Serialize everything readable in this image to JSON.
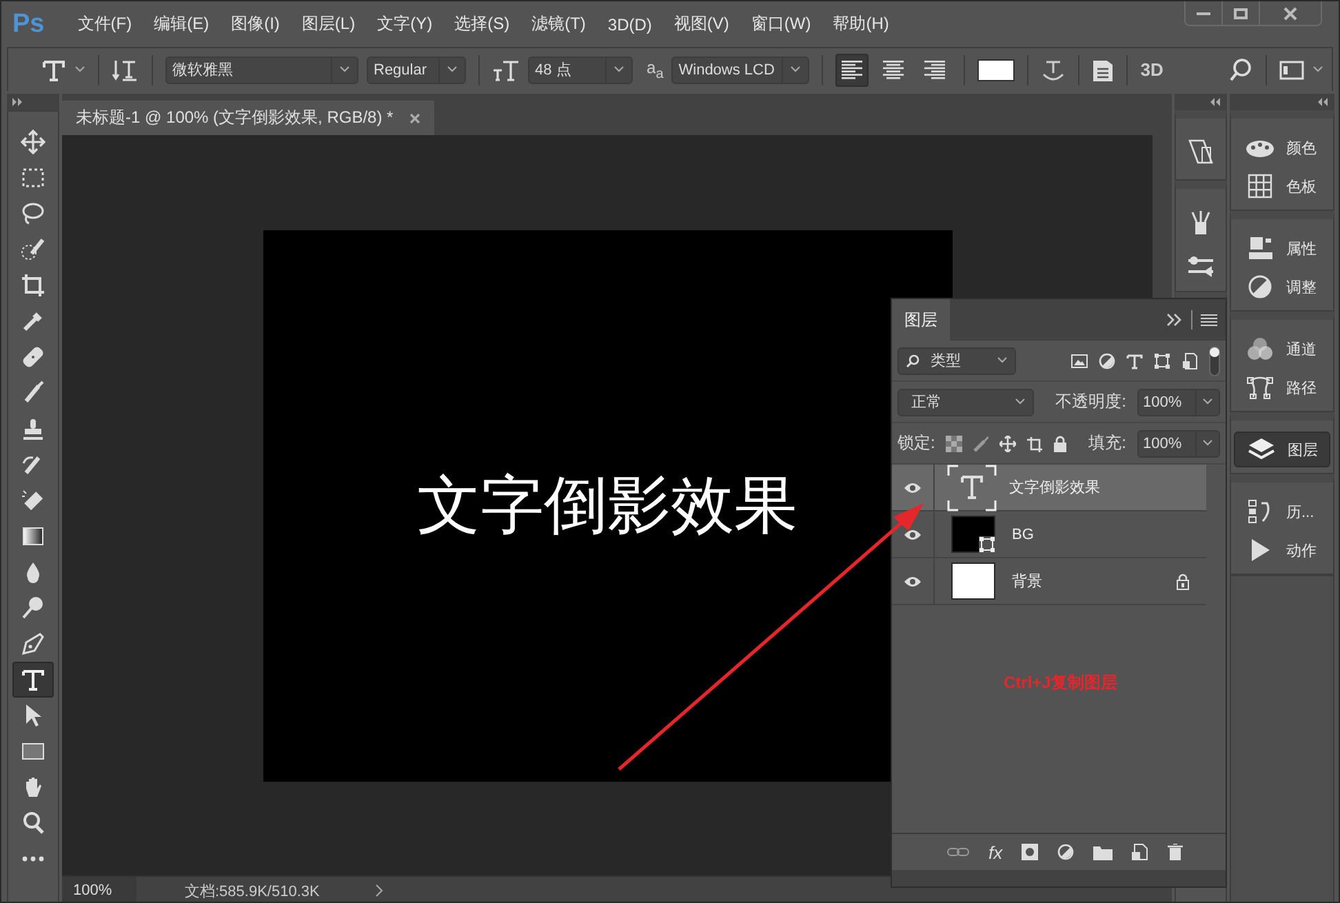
{
  "app": {
    "logo": "Ps"
  },
  "menu": [
    {
      "label": "文件(F)"
    },
    {
      "label": "编辑(E)"
    },
    {
      "label": "图像(I)"
    },
    {
      "label": "图层(L)"
    },
    {
      "label": "文字(Y)"
    },
    {
      "label": "选择(S)"
    },
    {
      "label": "滤镜(T)"
    },
    {
      "label": "3D(D)"
    },
    {
      "label": "视图(V)"
    },
    {
      "label": "窗口(W)"
    },
    {
      "label": "帮助(H)"
    }
  ],
  "options_bar": {
    "font_family": "微软雅黑",
    "font_style": "Regular",
    "font_size": "48 点",
    "antialias_icon": "a$_{a}$",
    "antialias": "Windows LCD",
    "align": [
      {
        "kind": "left",
        "selected": true
      },
      {
        "kind": "center",
        "selected": false
      },
      {
        "kind": "right",
        "selected": false
      }
    ],
    "three_d": "3D"
  },
  "document_tab": {
    "title": "未标题-1 @ 100% (文字倒影效果, RGB/8) *"
  },
  "tools": [
    {
      "kind": "move",
      "selected": false
    },
    {
      "kind": "marquee",
      "selected": false
    },
    {
      "kind": "lasso",
      "selected": false
    },
    {
      "kind": "quick-select",
      "selected": false
    },
    {
      "kind": "crop",
      "selected": false
    },
    {
      "kind": "eyedropper",
      "selected": false
    },
    {
      "kind": "healing",
      "selected": false
    },
    {
      "kind": "brush",
      "selected": false
    },
    {
      "kind": "stamp",
      "selected": false
    },
    {
      "kind": "history-brush",
      "selected": false
    },
    {
      "kind": "eraser",
      "selected": false
    },
    {
      "kind": "gradient",
      "selected": false
    },
    {
      "kind": "blur",
      "selected": false
    },
    {
      "kind": "dodge",
      "selected": false
    },
    {
      "kind": "pen",
      "selected": false
    },
    {
      "kind": "type",
      "selected": true
    },
    {
      "kind": "path-select",
      "selected": false
    },
    {
      "kind": "rectangle",
      "selected": false
    },
    {
      "kind": "hand",
      "selected": false
    },
    {
      "kind": "zoom",
      "selected": false
    },
    {
      "kind": "more",
      "selected": false
    }
  ],
  "canvas": {
    "text": "文字倒影效果"
  },
  "annotation": {
    "text": "Ctrl+J复制图层"
  },
  "status_bar": {
    "zoom": "100%",
    "doc_info": "文档:585.9K/510.3K"
  },
  "panel_groups": [
    {
      "items": [
        {
          "kind": "color",
          "label": "颜色",
          "selected": false
        },
        {
          "kind": "swatches",
          "label": "色板",
          "selected": false
        }
      ]
    },
    {
      "items": [
        {
          "kind": "properties",
          "label": "属性",
          "selected": false
        },
        {
          "kind": "adjustments",
          "label": "调整",
          "selected": false
        }
      ]
    },
    {
      "items": [
        {
          "kind": "channels",
          "label": "通道",
          "selected": false
        },
        {
          "kind": "paths",
          "label": "路径",
          "selected": false
        }
      ]
    },
    {
      "items": [
        {
          "kind": "layers",
          "label": "图层",
          "selected": true
        }
      ]
    },
    {
      "items": [
        {
          "kind": "history",
          "label": "历...",
          "selected": false
        },
        {
          "kind": "actions",
          "label": "动作",
          "selected": false
        }
      ]
    }
  ],
  "layers_panel": {
    "tab": "图层",
    "filter": "类型",
    "blend_mode": "正常",
    "opacity_label": "不透明度:",
    "opacity": "100%",
    "lock_label": "锁定:",
    "fill_label": "填充:",
    "fill": "100%",
    "footer_fx": "fx",
    "layers": [
      {
        "kind": "text",
        "name": "文字倒影效果",
        "selected": true,
        "visible": true,
        "locked": false
      },
      {
        "kind": "shape",
        "name": "BG",
        "selected": false,
        "visible": true,
        "locked": false
      },
      {
        "kind": "background",
        "name": "背景",
        "selected": false,
        "visible": true,
        "locked": true
      }
    ]
  }
}
